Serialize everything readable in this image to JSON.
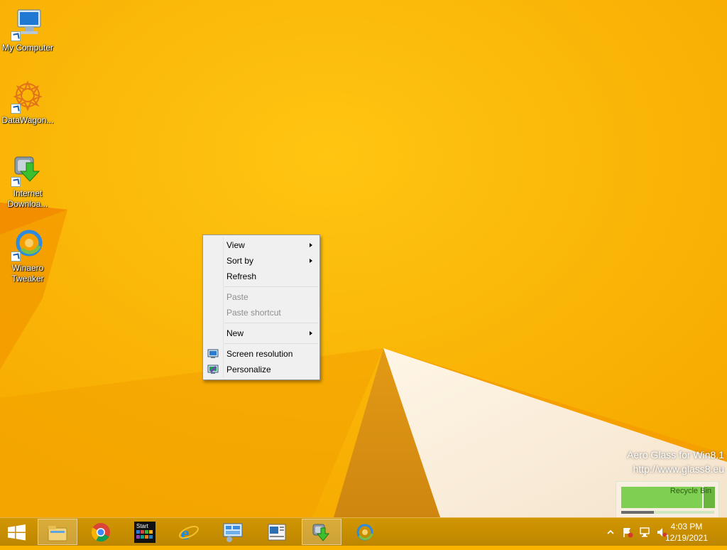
{
  "desktop": {
    "icons": [
      {
        "label": "My Computer",
        "icon": "my-computer-icon"
      },
      {
        "label": "DataWagon...",
        "icon": "datawagon-icon"
      },
      {
        "label": "Internet\nDownloa...",
        "icon": "internet-download-manager-icon"
      },
      {
        "label": "Winaero\nTweaker",
        "icon": "winaero-tweaker-icon"
      }
    ]
  },
  "context_menu": {
    "items": [
      {
        "label": "View",
        "submenu": true,
        "enabled": true
      },
      {
        "label": "Sort by",
        "submenu": true,
        "enabled": true
      },
      {
        "label": "Refresh",
        "submenu": false,
        "enabled": true
      },
      {
        "label": "Paste",
        "submenu": false,
        "enabled": false
      },
      {
        "label": "Paste shortcut",
        "submenu": false,
        "enabled": false
      },
      {
        "label": "New",
        "submenu": true,
        "enabled": true
      },
      {
        "label": "Screen resolution",
        "submenu": false,
        "enabled": true,
        "icon": "screen-resolution-icon"
      },
      {
        "label": "Personalize",
        "submenu": false,
        "enabled": true,
        "icon": "personalize-icon"
      }
    ]
  },
  "watermark": {
    "line1": "Aero Glass for Win8.1",
    "line2": "http://www.glass8.eu"
  },
  "idm_gadget": {
    "label": "Recycle Bin",
    "progress": 0.35
  },
  "taskbar": {
    "apps": [
      {
        "name": "file-explorer",
        "icon": "file-explorer-icon",
        "active": true
      },
      {
        "name": "chrome",
        "icon": "chrome-icon",
        "active": false
      },
      {
        "name": "start-screen-app",
        "icon": "start-app-icon",
        "label": "Start",
        "active": false
      },
      {
        "name": "internet-explorer",
        "icon": "internet-explorer-icon",
        "active": false
      },
      {
        "name": "control-panel",
        "icon": "control-panel-icon",
        "active": false
      },
      {
        "name": "document-viewer",
        "icon": "document-icon",
        "active": false
      },
      {
        "name": "internet-download-manager",
        "icon": "internet-download-manager-icon",
        "active": true
      },
      {
        "name": "winaero-tweaker",
        "icon": "winaero-tweaker-icon",
        "active": false
      }
    ],
    "tray": {
      "icons": [
        "show-hidden-icons-chevron",
        "action-center-flag-icon",
        "network-icon",
        "volume-muted-icon"
      ],
      "time": "4:03 PM",
      "date": "12/19/2021"
    }
  },
  "colors": {
    "wallpaper": "#f9b400",
    "taskbar": "#c88f00",
    "menu_bg": "#f0f0f0"
  }
}
